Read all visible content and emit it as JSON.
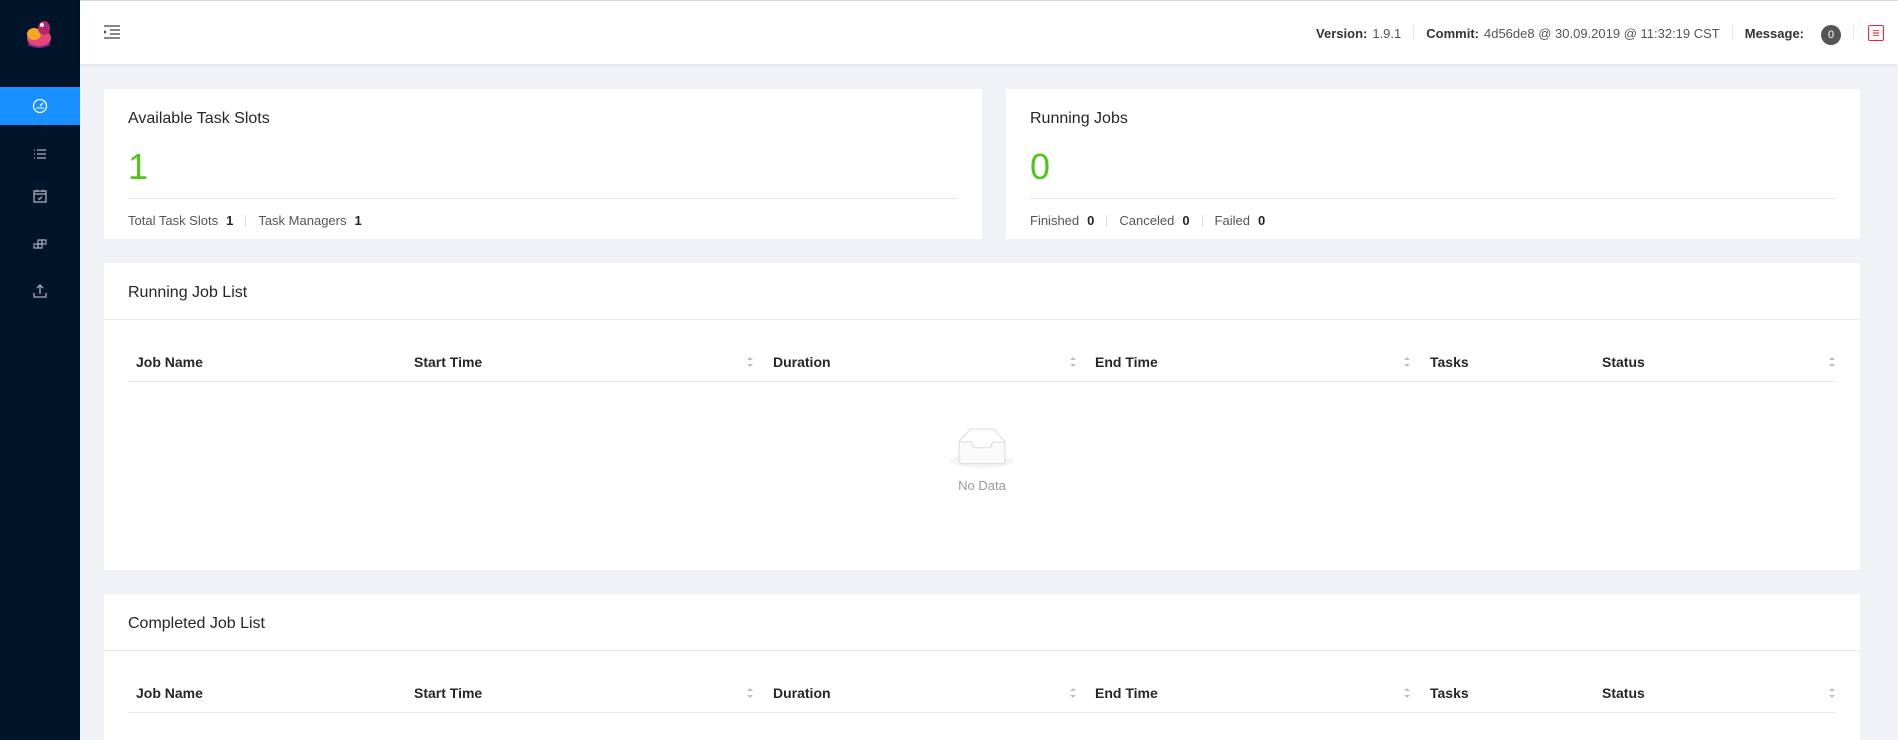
{
  "sidebar": {
    "logo": "flink-squirrel-logo",
    "items": [
      {
        "icon": "dashboard-icon",
        "active": true
      },
      {
        "icon": "list-icon",
        "active": false
      },
      {
        "icon": "calendar-icon",
        "active": false
      },
      {
        "icon": "cluster-icon",
        "active": false
      },
      {
        "icon": "upload-icon",
        "active": false
      }
    ]
  },
  "header": {
    "version_label": "Version:",
    "version_value": "1.9.1",
    "commit_label": "Commit:",
    "commit_value": "4d56de8 @ 30.09.2019 @ 11:32:19 CST",
    "message_label": "Message:",
    "message_count": "0"
  },
  "slots_card": {
    "title": "Available Task Slots",
    "value": "1",
    "total_label": "Total Task Slots",
    "total_value": "1",
    "managers_label": "Task Managers",
    "managers_value": "1"
  },
  "jobs_card": {
    "title": "Running Jobs",
    "value": "0",
    "finished_label": "Finished",
    "finished_value": "0",
    "canceled_label": "Canceled",
    "canceled_value": "0",
    "failed_label": "Failed",
    "failed_value": "0"
  },
  "running_list": {
    "title": "Running Job List",
    "columns": [
      "Job Name",
      "Start Time",
      "Duration",
      "End Time",
      "Tasks",
      "Status"
    ],
    "empty_text": "No Data"
  },
  "completed_list": {
    "title": "Completed Job List",
    "columns": [
      "Job Name",
      "Start Time",
      "Duration",
      "End Time",
      "Tasks",
      "Status"
    ]
  },
  "colors": {
    "sidebar": "#001529",
    "active": "#1890ff",
    "big_number": "#52c41a",
    "close": "#f5222d"
  }
}
